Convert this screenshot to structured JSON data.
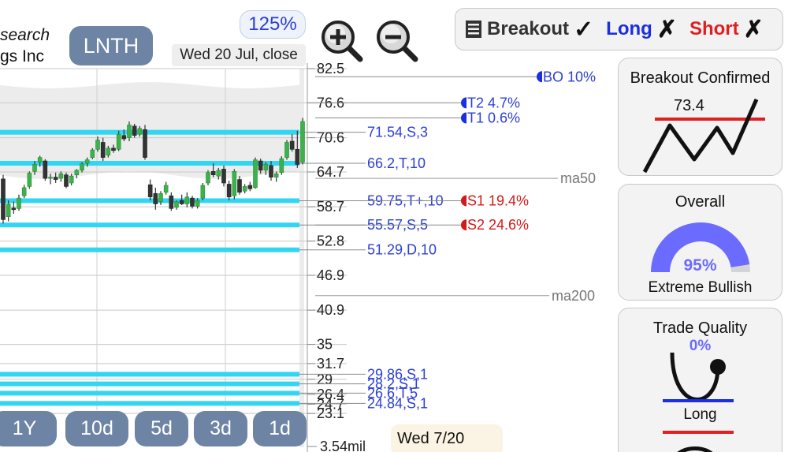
{
  "company": {
    "line1": "search",
    "line2": "gs Inc"
  },
  "ticker": "LNTH",
  "zoom": "125%",
  "quote_time": "Wed 20 Jul, close",
  "signals": {
    "breakout": {
      "label": "Breakout",
      "mark": "✓",
      "color": "#333333"
    },
    "long": {
      "label": "Long",
      "mark": "✗",
      "color": "#1b2ee0"
    },
    "short": {
      "label": "Short",
      "mark": "✗",
      "color": "#e02020"
    }
  },
  "price_axis": [
    "82.5",
    "76.6",
    "70.6",
    "64.7",
    "58.7",
    "52.8",
    "46.9",
    "40.9",
    "35",
    "31.7",
    "29",
    "26.4",
    "24.7",
    "23.1"
  ],
  "volume_label": "3.54mil",
  "levels": [
    {
      "price": 71.54,
      "label": "71.54,S,3"
    },
    {
      "price": 66.2,
      "label": "66.2,T,10"
    },
    {
      "price": 59.75,
      "label": "59.75,T+,10"
    },
    {
      "price": 55.57,
      "label": "55.57,S,5"
    },
    {
      "price": 51.29,
      "label": "51.29,D,10"
    },
    {
      "price": 29.86,
      "label": "29.86,S,1"
    },
    {
      "price": 28.2,
      "label": "28.2,S,1"
    },
    {
      "price": 26.6,
      "label": "26.6,T,5"
    },
    {
      "price": 24.84,
      "label": "24.84,S,1"
    }
  ],
  "targets": [
    {
      "label": "BO 10%",
      "kind": "blue"
    },
    {
      "label": "T2 4.7%",
      "kind": "blue"
    },
    {
      "label": "T1 0.6%",
      "kind": "blue"
    },
    {
      "label": "S1 19.4%",
      "kind": "red"
    },
    {
      "label": "S2 24.6%",
      "kind": "red"
    }
  ],
  "moving_averages": {
    "ma50": "ma50",
    "ma200": "ma200"
  },
  "candles": [
    {
      "o": 63.5,
      "h": 64.2,
      "l": 55.8,
      "c": 56.5
    },
    {
      "o": 57.0,
      "h": 59.8,
      "l": 56.2,
      "c": 59.2
    },
    {
      "o": 58.5,
      "h": 59.6,
      "l": 57.5,
      "c": 58.2
    },
    {
      "o": 58.4,
      "h": 60.8,
      "l": 58.0,
      "c": 60.2
    },
    {
      "o": 60.6,
      "h": 62.5,
      "l": 60.2,
      "c": 62.0
    },
    {
      "o": 62.2,
      "h": 64.8,
      "l": 61.8,
      "c": 64.5
    },
    {
      "o": 64.8,
      "h": 66.6,
      "l": 64.2,
      "c": 66.0
    },
    {
      "o": 66.4,
      "h": 67.5,
      "l": 65.6,
      "c": 67.2
    },
    {
      "o": 66.6,
      "h": 66.9,
      "l": 63.2,
      "c": 63.6
    },
    {
      "o": 63.6,
      "h": 64.4,
      "l": 62.6,
      "c": 63.8
    },
    {
      "o": 63.8,
      "h": 64.6,
      "l": 62.8,
      "c": 63.4
    },
    {
      "o": 63.6,
      "h": 64.8,
      "l": 63.0,
      "c": 64.4
    },
    {
      "o": 64.2,
      "h": 64.6,
      "l": 61.9,
      "c": 62.2
    },
    {
      "o": 62.8,
      "h": 64.4,
      "l": 62.4,
      "c": 64.0
    },
    {
      "o": 64.2,
      "h": 65.2,
      "l": 63.6,
      "c": 65.0
    },
    {
      "o": 65.0,
      "h": 66.4,
      "l": 64.6,
      "c": 66.1
    },
    {
      "o": 66.2,
      "h": 67.2,
      "l": 65.6,
      "c": 66.8
    },
    {
      "o": 67.2,
      "h": 68.8,
      "l": 66.9,
      "c": 68.5
    },
    {
      "o": 68.6,
      "h": 70.8,
      "l": 68.2,
      "c": 70.2
    },
    {
      "o": 69.8,
      "h": 70.6,
      "l": 66.6,
      "c": 67.2
    },
    {
      "o": 67.6,
      "h": 69.2,
      "l": 67.2,
      "c": 68.8
    },
    {
      "o": 68.8,
      "h": 69.4,
      "l": 68.0,
      "c": 68.4
    },
    {
      "o": 68.6,
      "h": 71.8,
      "l": 68.3,
      "c": 71.2
    },
    {
      "o": 71.0,
      "h": 72.0,
      "l": 70.0,
      "c": 70.4
    },
    {
      "o": 70.6,
      "h": 73.4,
      "l": 70.0,
      "c": 72.8
    },
    {
      "o": 72.6,
      "h": 73.0,
      "l": 70.6,
      "c": 71.0
    },
    {
      "o": 71.2,
      "h": 72.6,
      "l": 70.8,
      "c": 72.2
    },
    {
      "o": 72.0,
      "h": 72.8,
      "l": 66.8,
      "c": 67.2
    },
    {
      "o": 62.5,
      "h": 63.4,
      "l": 59.8,
      "c": 60.4
    },
    {
      "o": 61.0,
      "h": 62.0,
      "l": 58.2,
      "c": 59.2
    },
    {
      "o": 59.6,
      "h": 61.4,
      "l": 59.0,
      "c": 61.0
    },
    {
      "o": 61.2,
      "h": 63.0,
      "l": 60.8,
      "c": 62.4
    },
    {
      "o": 60.6,
      "h": 61.2,
      "l": 58.0,
      "c": 58.4
    },
    {
      "o": 58.6,
      "h": 59.8,
      "l": 58.2,
      "c": 59.6
    },
    {
      "o": 59.8,
      "h": 60.8,
      "l": 59.0,
      "c": 59.2
    },
    {
      "o": 59.2,
      "h": 61.2,
      "l": 58.6,
      "c": 60.4
    },
    {
      "o": 60.2,
      "h": 60.6,
      "l": 58.4,
      "c": 58.8
    },
    {
      "o": 58.8,
      "h": 60.2,
      "l": 58.4,
      "c": 59.8
    },
    {
      "o": 60.2,
      "h": 62.8,
      "l": 59.8,
      "c": 62.4
    },
    {
      "o": 62.8,
      "h": 65.0,
      "l": 62.4,
      "c": 64.6
    },
    {
      "o": 64.8,
      "h": 66.2,
      "l": 63.8,
      "c": 64.2
    },
    {
      "o": 64.0,
      "h": 65.4,
      "l": 63.4,
      "c": 65.0
    },
    {
      "o": 65.2,
      "h": 65.8,
      "l": 62.2,
      "c": 62.8
    },
    {
      "o": 62.6,
      "h": 63.2,
      "l": 59.8,
      "c": 60.4
    },
    {
      "o": 60.6,
      "h": 65.2,
      "l": 60.0,
      "c": 64.8
    },
    {
      "o": 63.4,
      "h": 64.0,
      "l": 60.8,
      "c": 61.2
    },
    {
      "o": 61.4,
      "h": 62.6,
      "l": 61.0,
      "c": 62.2
    },
    {
      "o": 62.4,
      "h": 63.0,
      "l": 61.4,
      "c": 61.8
    },
    {
      "o": 62.0,
      "h": 67.2,
      "l": 61.8,
      "c": 66.8
    },
    {
      "o": 66.6,
      "h": 67.0,
      "l": 64.4,
      "c": 65.0
    },
    {
      "o": 65.0,
      "h": 66.4,
      "l": 64.2,
      "c": 66.0
    },
    {
      "o": 65.8,
      "h": 66.6,
      "l": 63.2,
      "c": 63.8
    },
    {
      "o": 63.8,
      "h": 64.8,
      "l": 63.0,
      "c": 64.4
    },
    {
      "o": 64.6,
      "h": 67.4,
      "l": 64.2,
      "c": 67.0
    },
    {
      "o": 67.2,
      "h": 70.2,
      "l": 66.8,
      "c": 69.8
    },
    {
      "o": 70.0,
      "h": 71.2,
      "l": 68.2,
      "c": 68.6
    },
    {
      "o": 68.6,
      "h": 71.8,
      "l": 65.4,
      "c": 66.0
    },
    {
      "o": 66.4,
      "h": 74.0,
      "l": 66.0,
      "c": 73.4
    }
  ],
  "panels": {
    "breakout": {
      "title": "Breakout Confirmed",
      "value": "73.4"
    },
    "overall": {
      "title": "Overall",
      "value": "95%",
      "level": 0.95,
      "caption": "Extreme Bullish"
    },
    "trade_quality": {
      "title": "Trade Quality",
      "value": "0%",
      "caption": "Long"
    }
  },
  "periods": [
    "1Y",
    "10d",
    "5d",
    "3d",
    "1d"
  ],
  "tooltip_date": "Wed 7/20"
}
